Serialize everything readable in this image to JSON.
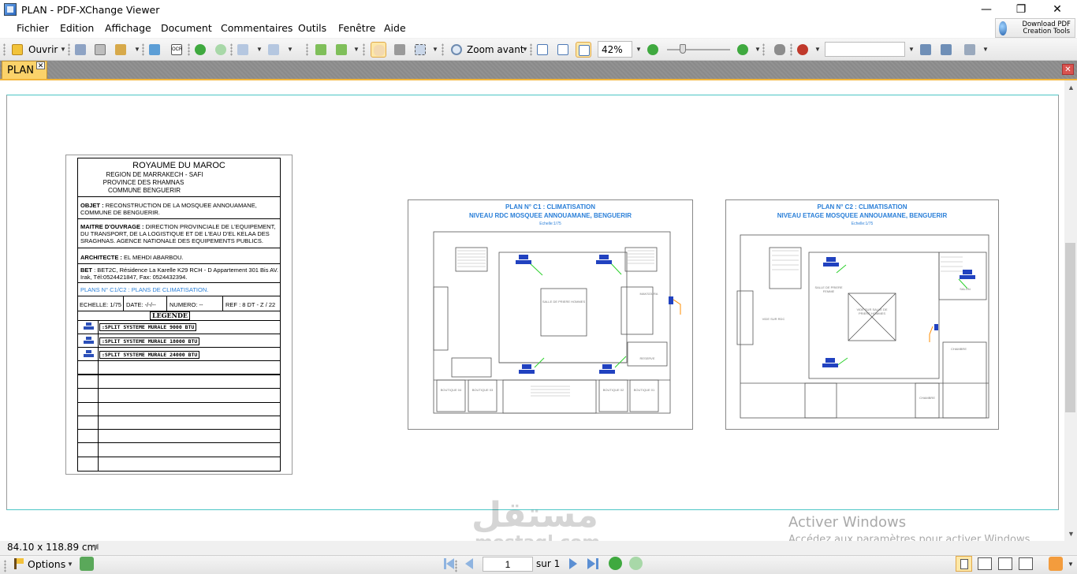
{
  "window": {
    "title": "PLAN - PDF-XChange Viewer",
    "minimize": "—",
    "restore": "❐",
    "close": "✕"
  },
  "menu": {
    "items": [
      "Fichier",
      "Edition",
      "Affichage",
      "Document",
      "Commentaires",
      "Outils",
      "Fenêtre",
      "Aide"
    ]
  },
  "download_button": {
    "label": "Download PDF Creation Tools"
  },
  "toolbar": {
    "open_label": "Ouvrir",
    "zoom_in_label": "Zoom avant",
    "zoom_value": "42%"
  },
  "tabs": {
    "doc_tab_label": "PLAN",
    "tab_close": "✕",
    "strip_close": "✕"
  },
  "title_block": {
    "kingdom": "ROYAUME DU MAROC",
    "region": "REGION DE MARRAKECH - SAFI",
    "province": "PROVINCE DES RHAMNAS",
    "commune": "COMMUNE BENGUERIR",
    "objet_label": "OBJET :",
    "objet_text": "RECONSTRUCTION DE LA MOSQUEE ANNOUAMANE, COMMUNE DE BENGUERIR.",
    "maitre_label": "MAITRE  D'OUVRAGE :",
    "maitre_text": "DIRECTION PROVINCIALE DE L'EQUIPEMENT, DU TRANSPORT, DE LA LOGISTIQUE ET DE L'EAU D'EL KELAA DES SRAGHNAS. AGENCE NATIONALE DES EQUIPEMENTS PUBLICS.",
    "architecte_label": "ARCHITECTE :",
    "architecte_text": "EL MEHDI ABARBOU.",
    "bet_label": "BET",
    "bet_text": ": BET2C, Résidence La Karelle K29 RCH - D  Appartement 301 Bis AV. Irak, Tél:0524421847, Fax: 0524432394.",
    "plans_text": "PLANS N° C1/C2 : PLANS DE CLIMATISATION.",
    "echelle": "ECHELLE: 1/75",
    "date": "DATE: -/-/--",
    "numero": "NUMERO: --",
    "ref": "REF : 8 DT - Z / 22",
    "legend_title": "LEGENDE",
    "legend_items": [
      ":SPLIT SYSTEME MURALE 9000 BTU",
      ":SPLIT SYSTEME MURALE 18000 BTU",
      ":SPLIT SYSTEME MURALE 24000 BTU"
    ]
  },
  "plans": [
    {
      "title": "PLAN N° C1 : CLIMATISATION",
      "subtitle": "NIVEAU RDC MOSQUEE ANNOUAMANE, BENGUERIR",
      "scale": "Echelle:1/75",
      "room_labels": [
        "SALLE DE PRIERE HOMMES",
        "MAKSOURA",
        "RESERVE",
        "BOUTIQUE 04",
        "BOUTIQUE 03",
        "BOUTIQUE 02",
        "BOUTIQUE 01"
      ]
    },
    {
      "title": "PLAN N° C2 : CLIMATISATION",
      "subtitle": "NIVEAU ETAGE MOSQUEE ANNOUAMANE, BENGUERIR",
      "scale": "Echelle:1/75",
      "room_labels": [
        "VIDE SUR RDC",
        "SALLE DE PRIERE FEMME",
        "VIDE SUR SALLE DE PRIERE HOMMES",
        "CHAMBRE",
        "CHAMBRE",
        "SALON"
      ]
    }
  ],
  "status": {
    "page_size": "84.10 x 118.89 cm",
    "options_label": "Options",
    "page_current": "1",
    "page_of": "sur 1"
  },
  "overlay": {
    "activate_title": "Activer Windows",
    "activate_sub": "Accédez aux paramètres pour activer Windows.",
    "watermark_top": "مستقل",
    "watermark_bottom": "mostaql.com"
  },
  "colors": {
    "accent_tab": "#fbd26a",
    "plan_title": "#2a7fd8",
    "ac_unit": "#2142c0",
    "page_border": "#4cc6c6"
  }
}
